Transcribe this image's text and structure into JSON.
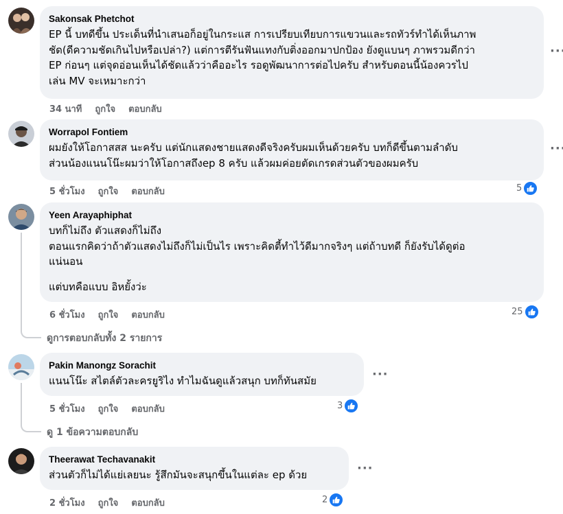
{
  "comments": [
    {
      "author": "Sakonsak Phetchot",
      "lines": [
        "EP นี้ บทดีขึ้น ประเด็นที่นำเสนอก็อยู่ในกระแส การเปรียบเทียบการแขวนและรถทัวร์ทำได้เห็นภาพ",
        "ชัด(ดีความชัดเกินไปหรือเปล่า?) แต่การตีรันฟันแทงกับติ่งออกมาปกป้อง ยังดูแบนๆ ภาพรวมดีกว่า",
        "EP ก่อนๆ แต่จุดอ่อนเห็นได้ชัดแล้วว่าคืออะไร รอดูพัฒนาการต่อไปครับ สำหรับตอนนี้น้องควรไป",
        "เล่น MV จะเหมาะกว่า"
      ],
      "time": "34 นาที",
      "like_label": "ถูกใจ",
      "reply_label": "ตอบกลับ"
    },
    {
      "author": "Worrapol Fontiem",
      "lines": [
        "ผมยังให้โอกาสสส นะครับ แต่นักแสดงชายแสดงดีจริงครับผมเห็นด้วยครับ บทก็ดีขึ้นตามลำดับ",
        "ส่วนน้องแนนโน๊ะผมว่าให้โอกาสถึงep 8 ครับ แล้วผมค่อยตัดเกรดส่วนตัวของผมครับ"
      ],
      "time": "5 ชั่วโมง",
      "like_label": "ถูกใจ",
      "reply_label": "ตอบกลับ",
      "reactions": "5"
    },
    {
      "author": "Yeen Arayaphiphat",
      "lines": [
        "บทก็ไม่ถึง ตัวแสดงก็ไม่ถึง",
        "ตอนแรกคิดว่าถ้าตัวแสดงไม่ถึงก็ไม่เป็นไร เพราะคิดตี้ทำไว้ดีมากจริงๆ แต่ถ้าบทดี ก็ยังรับได้ดูต่อ",
        "แน่นอน"
      ],
      "extra_line": "แต่บทคือแบบ อิหยั้งว่ะ",
      "time": "6 ชั่วโมง",
      "like_label": "ถูกใจ",
      "reply_label": "ตอบกลับ",
      "reactions": "25",
      "replies_link": "ดูการตอบกลับทั้ง 2 รายการ"
    },
    {
      "author": "Pakin Manongz Sorachit",
      "lines": [
        "แนนโน๊ะ สไตล์ตัวละครยูริไง ทำไมฉันดูแล้วสนุก บทก็ทันสมัย"
      ],
      "time": "5 ชั่วโมง",
      "like_label": "ถูกใจ",
      "reply_label": "ตอบกลับ",
      "reactions": "3",
      "replies_link": "ดู 1 ข้อความตอบกลับ"
    },
    {
      "author": "Theerawat Techavanakit",
      "lines": [
        "ส่วนตัวก็ไม่ได้แย่เลยนะ รู้สึกมันจะสนุกขึ้นในแต่ละ ep ด้วย"
      ],
      "time": "2 ชั่วโมง",
      "like_label": "ถูกใจ",
      "reply_label": "ตอบกลับ",
      "reactions": "2"
    }
  ],
  "colors": {
    "bubble": "#f0f2f5",
    "muted": "#65676b",
    "like_blue": "#1877f2",
    "thread": "#ced0d4"
  },
  "icons": {
    "more": "more-options-icon",
    "like": "like-thumb-icon"
  }
}
